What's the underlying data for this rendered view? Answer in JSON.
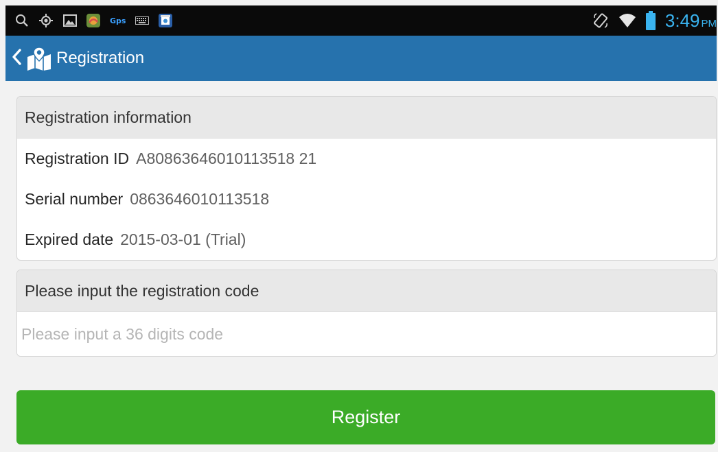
{
  "status_bar": {
    "left_icons": [
      "search-icon",
      "location-target-icon",
      "image-icon",
      "app-icon",
      "gps-label",
      "keyboard-icon",
      "store-icon"
    ],
    "gps_label": "Gps",
    "right_icons": [
      "rotation-icon",
      "wifi-icon",
      "battery-icon"
    ],
    "time": "3:49",
    "ampm": "PM"
  },
  "app_bar": {
    "title": "Registration",
    "back_icon": "chevron-left-icon",
    "logo_icon": "map-pin-logo-icon",
    "background_color": "#2672ad"
  },
  "registration_info": {
    "header": "Registration information",
    "rows": [
      {
        "label": "Registration ID",
        "value": "A80863646010113518 21"
      },
      {
        "label": "Serial number",
        "value": "0863646010113518"
      },
      {
        "label": "Expired date",
        "value": "2015-03-01 (Trial)"
      }
    ]
  },
  "registration_code": {
    "header": "Please input the registration code",
    "placeholder": "Please input a 36 digits code",
    "value": ""
  },
  "register_button": {
    "label": "Register",
    "color": "#3bab27"
  }
}
